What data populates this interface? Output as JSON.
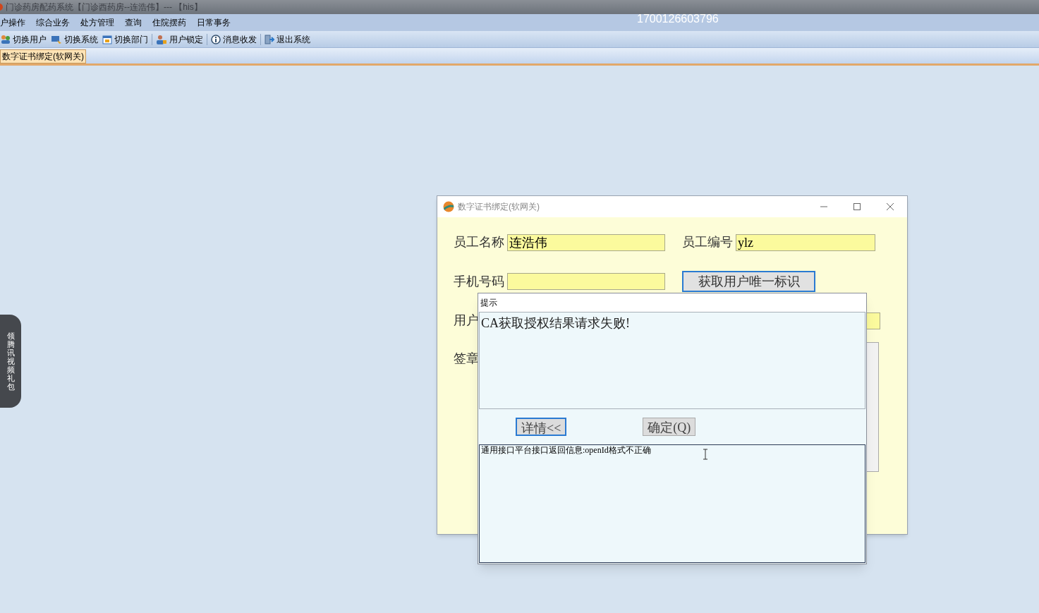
{
  "app_window": {
    "title": "门诊药房配药系统【门诊西药房--连浩伟】--- 【his】",
    "overlay_number": "1700126603796"
  },
  "menu": [
    "户操作",
    "综合业务",
    "处方管理",
    "查询",
    "住院摆药",
    "日常事务"
  ],
  "toolbar": [
    {
      "label": "切换用户",
      "kind": "users"
    },
    {
      "label": "切换系统",
      "kind": "switch"
    },
    {
      "label": "切换部门",
      "kind": "calendar"
    },
    {
      "label": "用户锁定",
      "kind": "lock"
    },
    {
      "label": "消息收发",
      "kind": "info"
    },
    {
      "label": "退出系统",
      "kind": "exit"
    }
  ],
  "tabs": [
    {
      "label": "数字证书绑定(软网关)",
      "selected": true
    }
  ],
  "side_tab": {
    "label": "领腾讯视频礼包"
  },
  "dialog": {
    "title": "数字证书绑定(软网关)",
    "fields": [
      {
        "label": "员工名称",
        "value": "连浩伟"
      },
      {
        "label": "员工编号",
        "value": "ylz"
      },
      {
        "label": "手机号码"
      }
    ],
    "button": "获取用户唯一标识",
    "covered_labels": [
      "用户",
      "签章"
    ]
  },
  "message_box": {
    "title": "提示",
    "message": "CA获取授权结果请求失败!",
    "buttons": [
      {
        "label": "详情<<",
        "focused": true
      },
      {
        "label": "确定(Q)",
        "focused": false
      }
    ],
    "details": "通用接口平台接口返回信息:openId格式不正确"
  }
}
